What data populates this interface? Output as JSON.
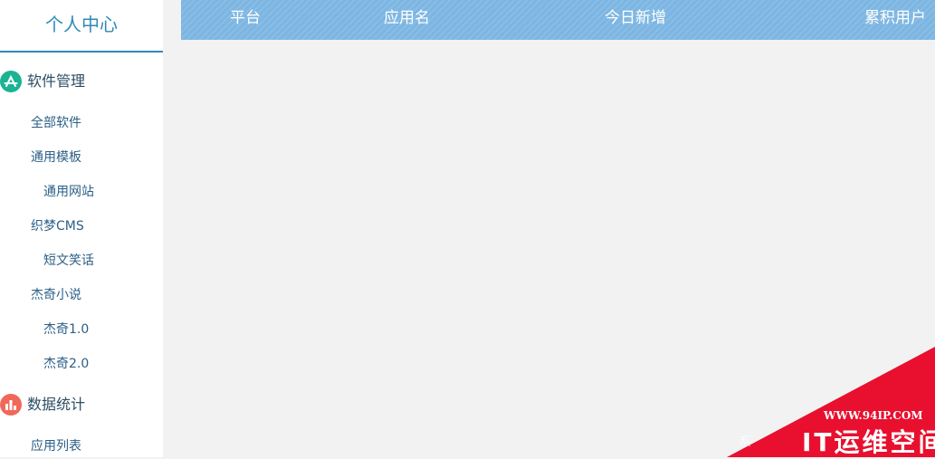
{
  "sidebar": {
    "title": "个人中心",
    "sections": [
      {
        "label": "软件管理",
        "icon": "app-store-icon",
        "color": "#1ab394",
        "items": [
          {
            "label": "全部软件",
            "level": 1
          },
          {
            "label": "通用模板",
            "level": 1
          },
          {
            "label": "通用网站",
            "level": 2
          },
          {
            "label": "织梦CMS",
            "level": 1
          },
          {
            "label": "短文笑话",
            "level": 2
          },
          {
            "label": "杰奇小说",
            "level": 1
          },
          {
            "label": "杰奇1.0",
            "level": 2
          },
          {
            "label": "杰奇2.0",
            "level": 2
          }
        ]
      },
      {
        "label": "数据统计",
        "icon": "bar-chart-icon",
        "color": "#f0685a",
        "items": [
          {
            "label": "应用列表",
            "level": 1
          }
        ]
      }
    ]
  },
  "table": {
    "headers": [
      "平台",
      "应用名",
      "今日新增",
      "累积用户"
    ]
  },
  "watermark": {
    "url": "WWW.94IP.COM",
    "name": "IT运维空间",
    "faint": "系"
  },
  "colors": {
    "accent": "#2f8ab8",
    "header": "#7db6e2",
    "watermark": "#e8102e"
  }
}
